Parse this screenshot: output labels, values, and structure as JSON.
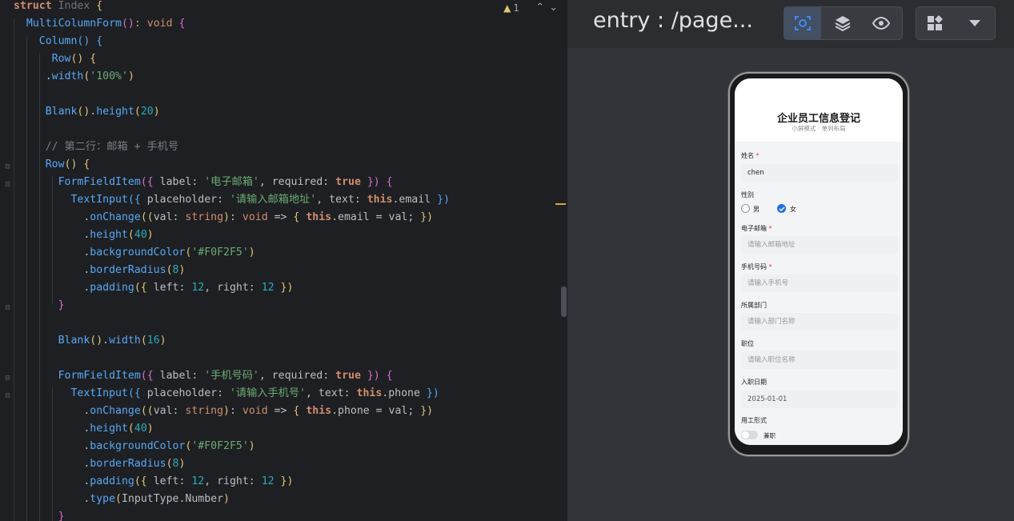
{
  "editor": {
    "warning_count": "1",
    "lines": [
      [
        [
          "kw",
          "struct "
        ],
        [
          "ty dim",
          "Index "
        ],
        [
          "br1",
          "{"
        ]
      ],
      [
        [
          "",
          "  "
        ],
        [
          "fn",
          "MultiColumnForm"
        ],
        [
          "br2",
          "()"
        ],
        [
          "kwn",
          ": void "
        ],
        [
          "br2",
          "{"
        ]
      ],
      [
        [
          "",
          "    "
        ],
        [
          "fn2",
          "Column"
        ],
        [
          "br3",
          "() {"
        ]
      ],
      [
        [
          "",
          "      "
        ],
        [
          "fn2",
          "Row"
        ],
        [
          "br1",
          "() {"
        ]
      ],
      [
        [
          "",
          "     ."
        ],
        [
          "fn",
          "width"
        ],
        [
          "br1",
          "("
        ],
        [
          "str",
          "'100%'"
        ],
        [
          "br1",
          ")"
        ]
      ],
      [
        [
          "",
          ""
        ]
      ],
      [
        [
          "",
          "     "
        ],
        [
          "fn2",
          "Blank"
        ],
        [
          "br1",
          "()"
        ],
        [
          "",
          "."
        ],
        [
          "fn",
          "height"
        ],
        [
          "br1",
          "("
        ],
        [
          "num",
          "20"
        ],
        [
          "br1",
          ")"
        ]
      ],
      [
        [
          "",
          ""
        ]
      ],
      [
        [
          "cm",
          "     // 第二行：邮箱 + 手机号"
        ]
      ],
      [
        [
          "",
          "     "
        ],
        [
          "fn2",
          "Row"
        ],
        [
          "br1",
          "() {"
        ]
      ],
      [
        [
          "",
          "       "
        ],
        [
          "fn2",
          "FormFieldItem"
        ],
        [
          "br2",
          "({ "
        ],
        [
          "",
          "label: "
        ],
        [
          "str",
          "'电子邮箱'"
        ],
        [
          "",
          ", required: "
        ],
        [
          "kw",
          "true"
        ],
        [
          "br2",
          " }) {"
        ]
      ],
      [
        [
          "",
          "         "
        ],
        [
          "fn2",
          "TextInput"
        ],
        [
          "br3",
          "({ "
        ],
        [
          "",
          "placeholder: "
        ],
        [
          "str",
          "'请输入邮箱地址'"
        ],
        [
          "",
          ", text: "
        ],
        [
          "kw",
          "this"
        ],
        [
          "",
          ".email "
        ],
        [
          "br3",
          "})"
        ]
      ],
      [
        [
          "",
          "           ."
        ],
        [
          "fn",
          "onChange"
        ],
        [
          "br1",
          "(("
        ],
        [
          "",
          "val: "
        ],
        [
          "kwn",
          "string"
        ],
        [
          "br1",
          ")"
        ],
        [
          "",
          ": "
        ],
        [
          "kwn",
          "void "
        ],
        [
          "",
          "=> "
        ],
        [
          "br1",
          "{ "
        ],
        [
          "kw",
          "this"
        ],
        [
          "",
          ".email = val; "
        ],
        [
          "br1",
          "})"
        ]
      ],
      [
        [
          "",
          "           ."
        ],
        [
          "fn",
          "height"
        ],
        [
          "br1",
          "("
        ],
        [
          "num",
          "40"
        ],
        [
          "br1",
          ")"
        ]
      ],
      [
        [
          "",
          "           ."
        ],
        [
          "fn",
          "backgroundColor"
        ],
        [
          "br1",
          "("
        ],
        [
          "str",
          "'#F0F2F5'"
        ],
        [
          "br1",
          ")"
        ]
      ],
      [
        [
          "",
          "           ."
        ],
        [
          "fn",
          "borderRadius"
        ],
        [
          "br1",
          "("
        ],
        [
          "num",
          "8"
        ],
        [
          "br1",
          ")"
        ]
      ],
      [
        [
          "",
          "           ."
        ],
        [
          "fn",
          "padding"
        ],
        [
          "br1",
          "({ "
        ],
        [
          "",
          "left: "
        ],
        [
          "num",
          "12"
        ],
        [
          "",
          ", right: "
        ],
        [
          "num",
          "12"
        ],
        [
          "br1",
          " })"
        ]
      ],
      [
        [
          "br2",
          "       }"
        ]
      ],
      [
        [
          "",
          ""
        ]
      ],
      [
        [
          "",
          "       "
        ],
        [
          "fn2",
          "Blank"
        ],
        [
          "br1",
          "()"
        ],
        [
          "",
          "."
        ],
        [
          "fn",
          "width"
        ],
        [
          "br1",
          "("
        ],
        [
          "num",
          "16"
        ],
        [
          "br1",
          ")"
        ]
      ],
      [
        [
          "",
          ""
        ]
      ],
      [
        [
          "",
          "       "
        ],
        [
          "fn2",
          "FormFieldItem"
        ],
        [
          "br2",
          "({ "
        ],
        [
          "",
          "label: "
        ],
        [
          "str",
          "'手机号码'"
        ],
        [
          "",
          ", required: "
        ],
        [
          "kw",
          "true"
        ],
        [
          "br2",
          " }) {"
        ]
      ],
      [
        [
          "",
          "         "
        ],
        [
          "fn2",
          "TextInput"
        ],
        [
          "br3",
          "({ "
        ],
        [
          "",
          "placeholder: "
        ],
        [
          "str",
          "'请输入手机号'"
        ],
        [
          "",
          ", text: "
        ],
        [
          "kw",
          "this"
        ],
        [
          "",
          ".phone "
        ],
        [
          "br3",
          "})"
        ]
      ],
      [
        [
          "",
          "           ."
        ],
        [
          "fn",
          "onChange"
        ],
        [
          "br1",
          "(("
        ],
        [
          "",
          "val: "
        ],
        [
          "kwn",
          "string"
        ],
        [
          "br1",
          ")"
        ],
        [
          "",
          ": "
        ],
        [
          "kwn",
          "void "
        ],
        [
          "",
          "=> "
        ],
        [
          "br1",
          "{ "
        ],
        [
          "kw",
          "this"
        ],
        [
          "",
          ".phone = val; "
        ],
        [
          "br1",
          "})"
        ]
      ],
      [
        [
          "",
          "           ."
        ],
        [
          "fn",
          "height"
        ],
        [
          "br1",
          "("
        ],
        [
          "num",
          "40"
        ],
        [
          "br1",
          ")"
        ]
      ],
      [
        [
          "",
          "           ."
        ],
        [
          "fn",
          "backgroundColor"
        ],
        [
          "br1",
          "("
        ],
        [
          "str",
          "'#F0F2F5'"
        ],
        [
          "br1",
          ")"
        ]
      ],
      [
        [
          "",
          "           ."
        ],
        [
          "fn",
          "borderRadius"
        ],
        [
          "br1",
          "("
        ],
        [
          "num",
          "8"
        ],
        [
          "br1",
          ")"
        ]
      ],
      [
        [
          "",
          "           ."
        ],
        [
          "fn",
          "padding"
        ],
        [
          "br1",
          "({ "
        ],
        [
          "",
          "left: "
        ],
        [
          "num",
          "12"
        ],
        [
          "",
          ", right: "
        ],
        [
          "num",
          "12"
        ],
        [
          "br1",
          " })"
        ]
      ],
      [
        [
          "",
          "           ."
        ],
        [
          "fn",
          "type"
        ],
        [
          "br1",
          "("
        ],
        [
          "",
          "InputType.Number"
        ],
        [
          "br1",
          ")"
        ]
      ],
      [
        [
          "br2",
          "       }"
        ]
      ]
    ]
  },
  "preview": {
    "title": "entry : /page...",
    "tools": [
      "inspect-icon",
      "layers-icon",
      "eye-icon",
      "components-icon",
      "chevron-down-icon"
    ]
  },
  "app": {
    "title": "企业员工信息登记",
    "subtitle": "小屏模式 · 单列布局",
    "fields": {
      "name_label": "姓名",
      "name_value": "chen",
      "gender_label": "性别",
      "gender_male": "男",
      "gender_female": "女",
      "gender_selected": "女",
      "email_label": "电子邮箱",
      "email_placeholder": "请输入邮箱地址",
      "phone_label": "手机号码",
      "phone_placeholder": "请输入手机号",
      "dept_label": "所属部门",
      "dept_placeholder": "请输入部门名称",
      "position_label": "职位",
      "position_placeholder": "请输入职位名称",
      "date_label": "入职日期",
      "date_value": "2025-01-01",
      "employ_label": "用工形式",
      "employ_toggle_label": "兼职",
      "required_mark": "*"
    }
  }
}
